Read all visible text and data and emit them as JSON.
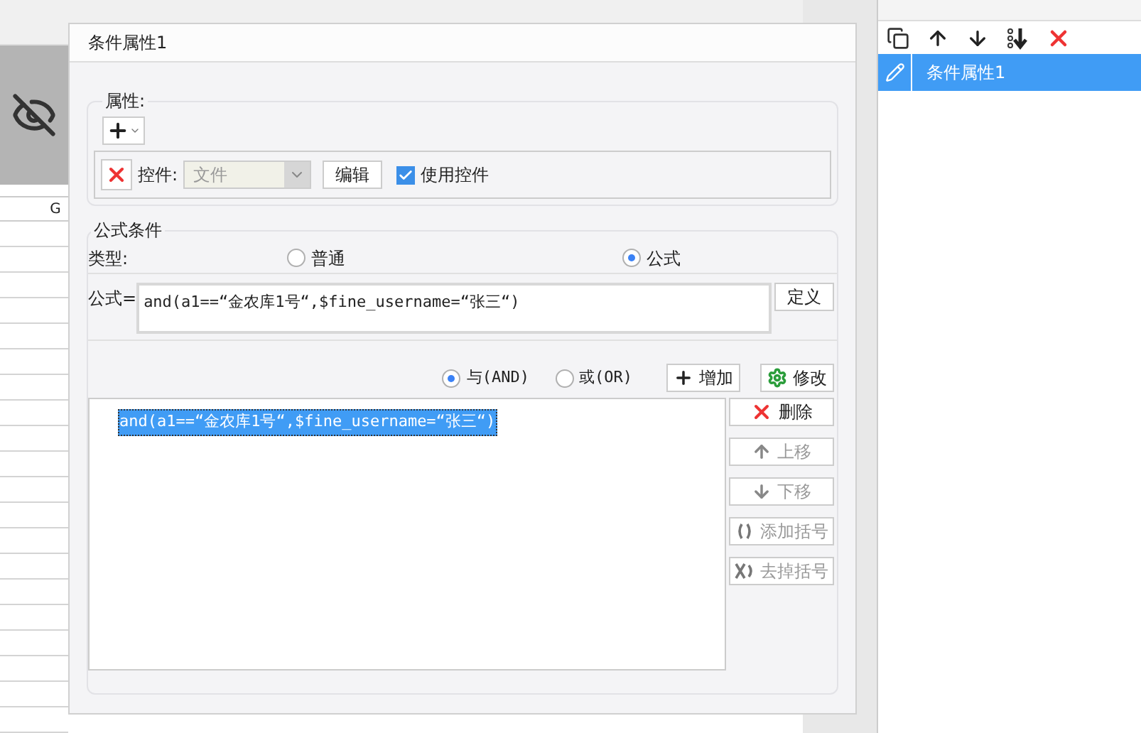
{
  "background": {
    "column_header": "G"
  },
  "dialog": {
    "title": "条件属性1",
    "attributes": {
      "legend": "属性:",
      "control_label": "控件:",
      "control_value": "文件",
      "edit_button": "编辑",
      "use_control": {
        "label": "使用控件",
        "checked": true
      }
    },
    "formula_condition": {
      "legend": "公式条件",
      "type_label": "类型:",
      "types": [
        {
          "label": "普通",
          "selected": false
        },
        {
          "label": "公式",
          "selected": true
        }
      ],
      "formula_label": "公式=",
      "formula_value": "and(a1==“金农库1号“,$fine_username=“张三“)",
      "define_button": "定义",
      "joins": [
        {
          "label": "与(AND)",
          "selected": true
        },
        {
          "label": "或(OR)",
          "selected": false
        }
      ],
      "add_button": "增加",
      "modify_button": "修改",
      "conditions": [
        {
          "text": "and(a1==“金农库1号“,$fine_username=“张三“)",
          "selected": true
        }
      ],
      "side_buttons": [
        {
          "kind": "delete",
          "label": "删除",
          "disabled": false
        },
        {
          "kind": "up",
          "label": "上移",
          "disabled": true
        },
        {
          "kind": "down",
          "label": "下移",
          "disabled": true
        },
        {
          "kind": "add_paren",
          "label": "添加括号",
          "disabled": true
        },
        {
          "kind": "remove_paren",
          "label": "去掉括号",
          "disabled": true
        }
      ]
    }
  },
  "condition_list": {
    "items": [
      {
        "label": "条件属性1",
        "selected": true
      }
    ]
  }
}
